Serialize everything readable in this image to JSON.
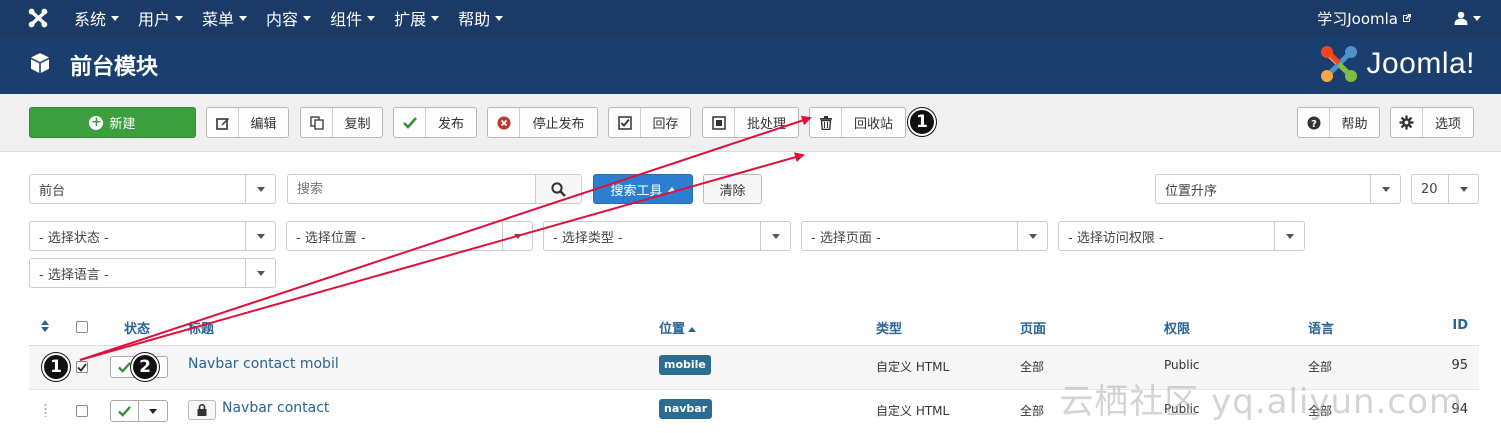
{
  "topnav": {
    "menu": [
      "系统",
      "用户",
      "菜单",
      "内容",
      "组件",
      "扩展",
      "帮助"
    ],
    "site_link": "学习Joomla"
  },
  "titlebar": {
    "title": "前台模块",
    "brand": "Joomla!"
  },
  "toolbar": {
    "new": "新建",
    "edit": "编辑",
    "copy": "复制",
    "publish": "发布",
    "unpublish": "停止发布",
    "archive": "回存",
    "batch": "批处理",
    "trash": "回收站",
    "help": "帮助",
    "options": "选项"
  },
  "filters": {
    "client": "前台",
    "search_placeholder": "搜索",
    "search_tools": "搜索工具",
    "clear": "清除",
    "ordering": "位置升序",
    "limit": "20",
    "state": "- 选择状态 -",
    "position": "- 选择位置 -",
    "type": "- 选择类型 -",
    "page": "- 选择页面 -",
    "access": "- 选择访问权限 -",
    "language": "- 选择语言 -"
  },
  "table": {
    "headers": {
      "status": "状态",
      "title": "标题",
      "position": "位置",
      "type": "类型",
      "pages": "页面",
      "access": "权限",
      "language": "语言",
      "id": "ID"
    },
    "rows": [
      {
        "title": "Navbar contact mobil",
        "position": "mobile",
        "type": "自定义 HTML",
        "pages": "全部",
        "access": "Public",
        "language": "全部",
        "id": "95",
        "checked": true,
        "locked": false
      },
      {
        "title": "Navbar contact",
        "position": "navbar",
        "type": "自定义 HTML",
        "pages": "全部",
        "access": "Public",
        "language": "全部",
        "id": "94",
        "checked": false,
        "locked": true
      }
    ]
  },
  "annotations": {
    "marker1": "1",
    "marker2": "2",
    "arrow_color": "#e0103a"
  },
  "watermark": "云栖社区 yq.aliyun.com",
  "colors": {
    "nav_bg": "#1b3a66",
    "new_button": "#3b9e3f",
    "tools_button": "#2c7fd0",
    "badge": "#2a6d91",
    "link": "#2a6496"
  }
}
